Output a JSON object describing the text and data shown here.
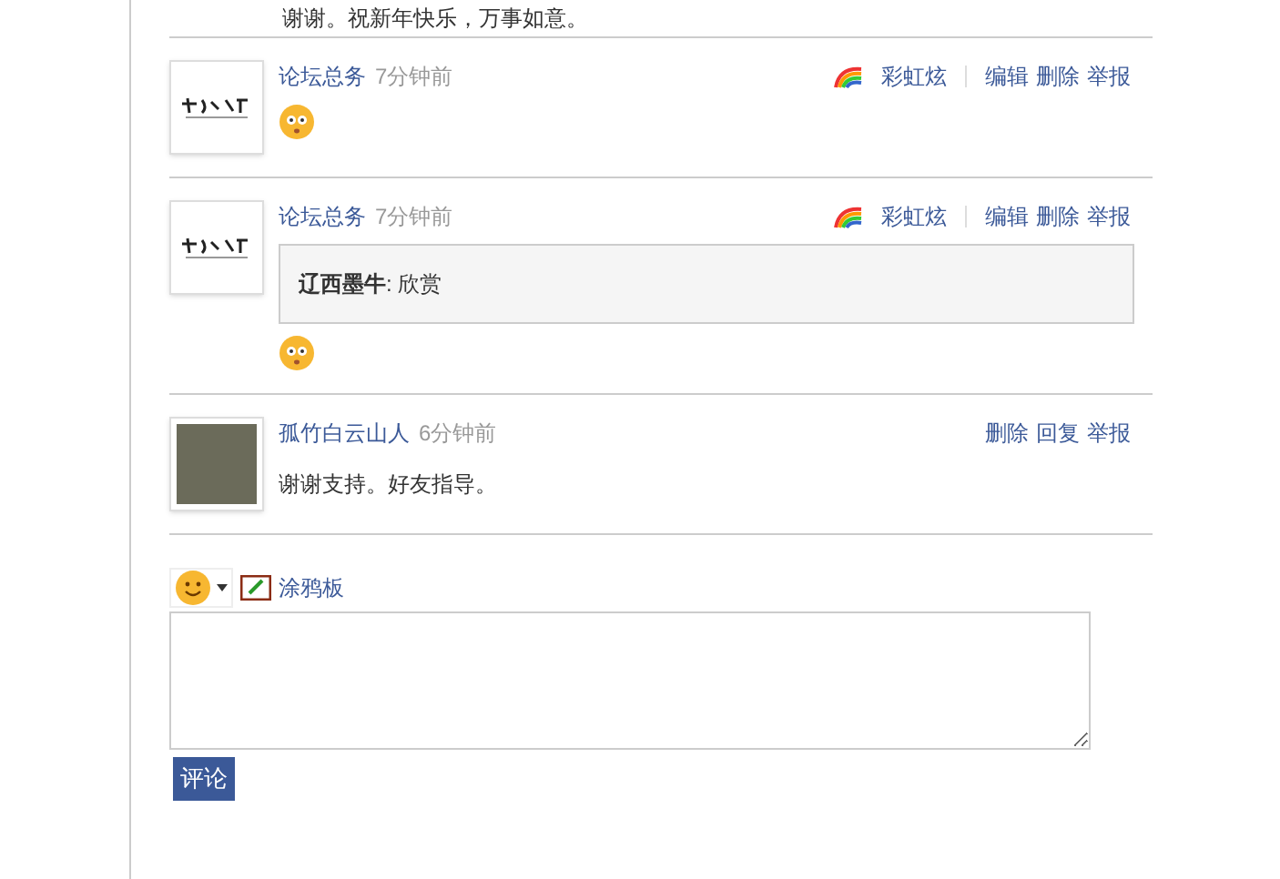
{
  "top_comment": {
    "text": "谢谢。祝新年快乐，万事如意。"
  },
  "comments": [
    {
      "kind": "logo",
      "author": "论坛总务",
      "time": "7分钟前",
      "badge": "彩虹炫",
      "actions": [
        "编辑",
        "删除",
        "举报"
      ],
      "emoji": true
    },
    {
      "kind": "logo",
      "author": "论坛总务",
      "time": "7分钟前",
      "badge": "彩虹炫",
      "actions": [
        "编辑",
        "删除",
        "举报"
      ],
      "quote": {
        "author": "辽西墨牛",
        "text": ": 欣赏"
      },
      "emoji": true
    },
    {
      "kind": "photo",
      "author": "孤竹白云山人",
      "time": "6分钟前",
      "actions": [
        "删除",
        "回复",
        "举报"
      ],
      "text": "谢谢支持。好友指导。",
      "emoji": false
    }
  ],
  "composer": {
    "doodle": "涂鸦板",
    "submit": "评论"
  }
}
